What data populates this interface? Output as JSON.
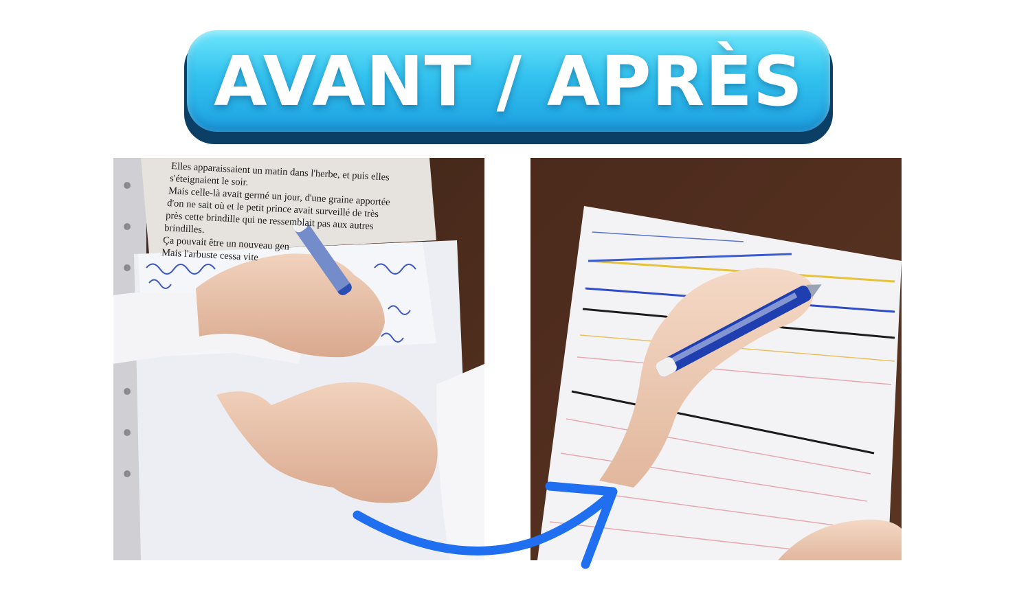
{
  "title": "AVANT / APRÈS",
  "colors": {
    "pill_light": "#6fe6fb",
    "pill_dark": "#1d9fe0",
    "pill_shadow": "#0b3f66",
    "arrow": "#1f6ff0",
    "wood": "#4a2a1c"
  },
  "before_photo": {
    "book_lines": [
      "Elles apparaissaient un matin dans l'herbe, et puis elles",
      "s'éteignaient le soir.",
      "Mais celle-là avait germé un jour, d'une graine apportée",
      "d'on ne sait où et le petit prince avait surveillé de très",
      "près cette brindille qui ne ressemblait pas aux autres",
      "brindilles.",
      "Ça pouvait être un nouveau gen",
      "Mais l'arbuste cessa vite"
    ]
  },
  "after_photo": {},
  "arrow_icon": "curved-arrow-icon"
}
